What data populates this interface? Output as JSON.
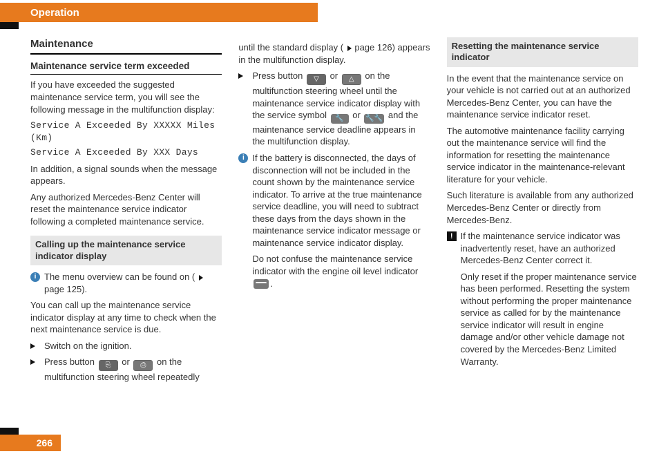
{
  "header": {
    "title": "Operation"
  },
  "footer": {
    "page_number": "266"
  },
  "col1": {
    "section_title": "Maintenance",
    "sub_title": "Maintenance service term exceeded",
    "p_intro": "If you have exceeded the suggested maintenance service term, you will see the following message in the multifunction display:",
    "msg1": "Service A Exceeded By XXXXX Miles (Km)",
    "msg2": "Service A Exceeded By XXX Days",
    "p_signal": "In addition, a signal sounds when the message appears.",
    "p_reset": "Any authorized Mercedes-Benz Center will reset the maintenance service indicator following a completed maintenance service.",
    "gray_heading": "Calling up the maintenance service indicator display",
    "info_a": "The menu overview can be found on (",
    "info_b": " page 125).",
    "p_callup": "You can call up the maintenance service indicator display at any time to check when the next maintenance service is due.",
    "step_ignition": "Switch on the ignition.",
    "step_press_a": "Press button ",
    "step_press_b": " or ",
    "step_press_c": " on the multifunction steering wheel repeatedly"
  },
  "col2": {
    "p_until_a": "until the standard display (",
    "p_until_b": " page 126) appears in the multifunction display.",
    "step_a": "Press button ",
    "step_b": " or ",
    "step_c": " on the multifunction steering wheel until the maintenance service indicator display with the service symbol ",
    "step_d": " or ",
    "step_e": " and the maintenance service deadline appears in the multifunction display.",
    "info_battery": "If the battery is disconnected, the days of disconnection will not be included in the count shown by the maintenance service indicator. To arrive at the true maintenance service deadline, you will need to subtract these days from the days shown in the maintenance service indicator message or maintenance service indicator display.",
    "p_confuse_a": "Do not confuse the maintenance service indicator with the engine oil level indicator ",
    "p_confuse_b": "."
  },
  "col3": {
    "gray_heading": "Resetting the maintenance service indicator",
    "p_event": "In the event that the maintenance service on your vehicle is not carried out at an authorized Mercedes-Benz Center, you can have the maintenance service indicator reset.",
    "p_facility": "The automotive maintenance facility carrying out the maintenance service will find the information for resetting the maintenance service indicator in the maintenance-relevant literature for your vehicle.",
    "p_literature": "Such literature is available from any authorized Mercedes-Benz Center or directly from Mercedes-Benz.",
    "warn_a": "If the maintenance service indicator was inadvertently reset, have an authorized Mercedes-Benz Center correct it.",
    "warn_b": "Only reset if the proper maintenance service has been performed. Resetting the system without performing the proper maintenance service as called for by the maintenance service indicator will result in engine damage and/or other vehicle damage not covered by the Mercedes-Benz Limited Warranty."
  }
}
